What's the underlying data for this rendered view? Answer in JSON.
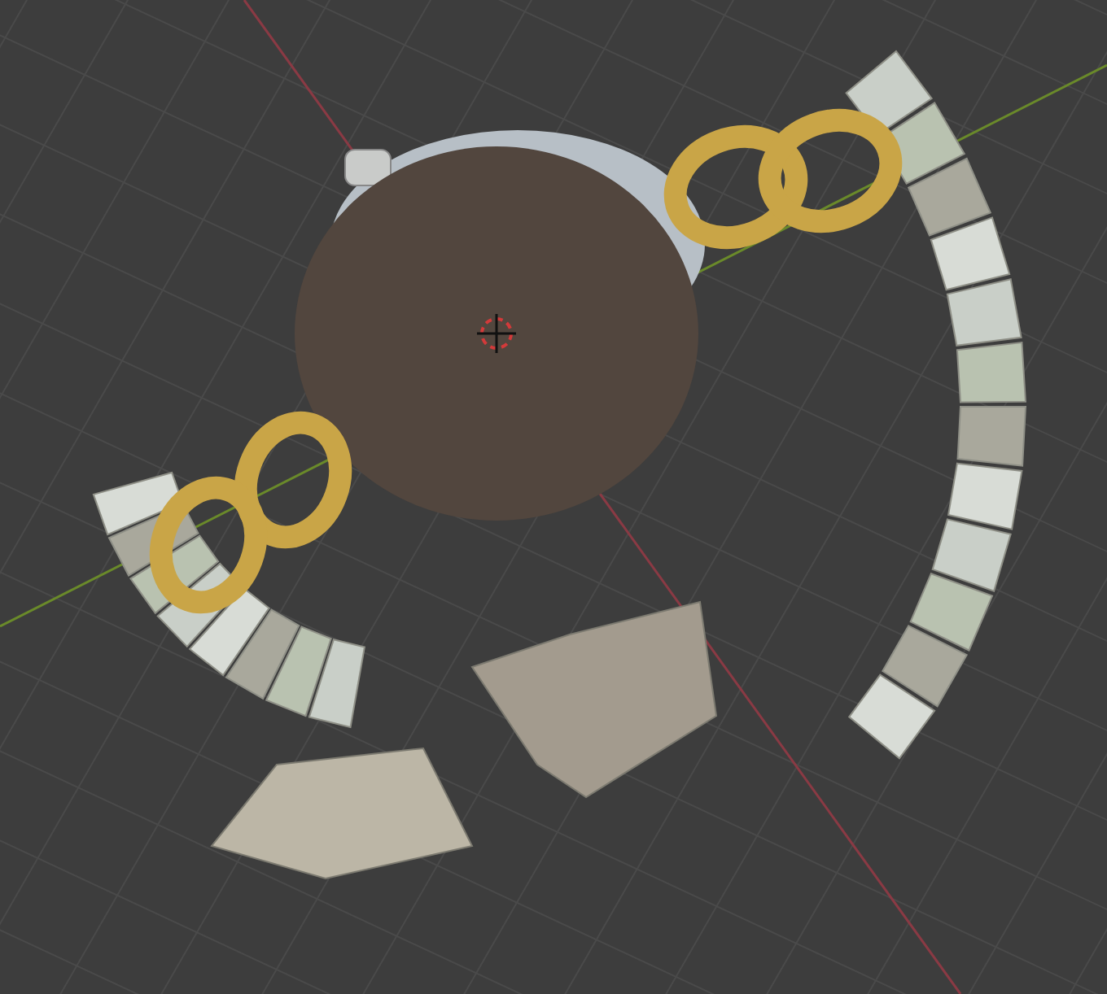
{
  "viewport": {
    "grid": true,
    "axes": true,
    "cursor": true
  }
}
